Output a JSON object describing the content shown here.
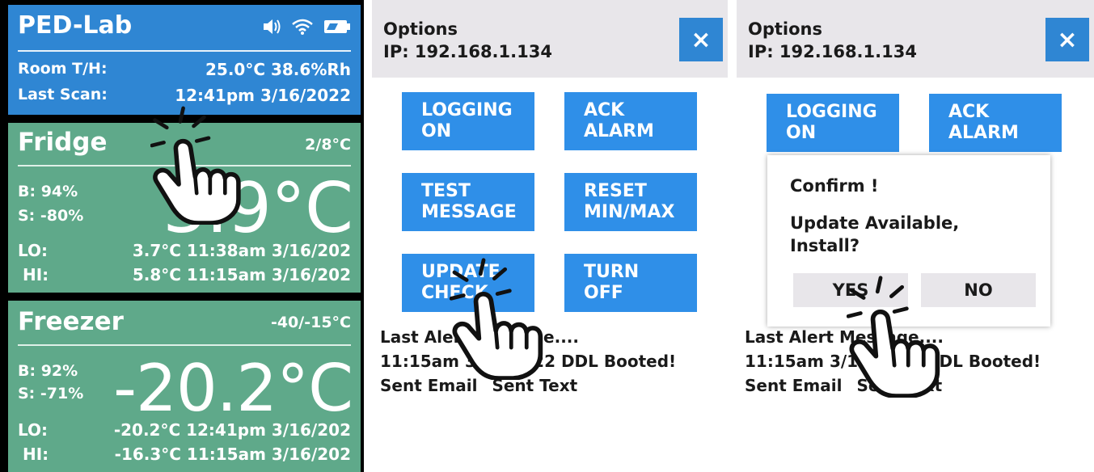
{
  "colors": {
    "header_blue": "#2f86d3",
    "zone_green": "#5fa98a",
    "button_blue": "#2f8fe8",
    "bar_gray": "#e8e6ea"
  },
  "dashboard": {
    "brand": "PED-Lab",
    "icons": [
      "speaker-icon",
      "wifi-icon",
      "battery-icon"
    ],
    "room_label": "Room T/H:",
    "room_value": "25.0°C  38.6%Rh",
    "scan_label": "Last Scan:",
    "scan_value": "12:41pm 3/16/2022",
    "fridge": {
      "name": "Fridge",
      "range": "2/8°C",
      "battery": "B:  94%",
      "signal": "S: -80%",
      "temp": "3.9°C",
      "lo_label": "LO:",
      "lo_value": "3.7°C 11:38am 3/16/202",
      "hi_label": "HI:",
      "hi_value": "5.8°C 11:15am 3/16/202"
    },
    "freezer": {
      "name": "Freezer",
      "range": "-40/-15°C",
      "battery": "B:  92%",
      "signal": "S:  -71%",
      "temp": "-20.2°C",
      "lo_label": "LO:",
      "lo_value": "-20.2°C 12:41pm 3/16/202",
      "hi_label": "HI:",
      "hi_value": "-16.3°C 11:15am 3/16/202"
    }
  },
  "options": {
    "title": "Options",
    "ip": "IP: 192.168.1.134",
    "close": "×",
    "buttons": {
      "logging": "LOGGING\nON",
      "ack": "ACK\nALARM",
      "test": "TEST\nMESSAGE",
      "reset": "RESET\nMIN/MAX",
      "update": "UPDATE\nCHECK",
      "turnoff": "TURN\nOFF"
    },
    "last_alert": "Last Alert Message....",
    "alert_line": "11:15am 3/16/2022 DDL Booted!",
    "sent_email": "Sent Email",
    "sent_text": "Sent Text"
  },
  "confirm": {
    "title": "Confirm !",
    "message": "Update Available, Install?",
    "yes": "YES",
    "no": "NO"
  }
}
